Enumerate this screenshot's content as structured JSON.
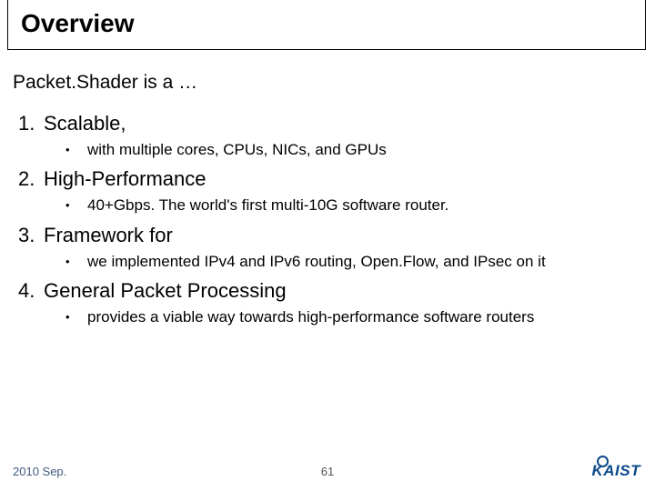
{
  "title": "Overview",
  "intro": "Packet.Shader is a …",
  "items": [
    {
      "head": "Scalable,",
      "sub": "with multiple cores, CPUs, NICs, and GPUs"
    },
    {
      "head": "High-Performance",
      "sub": "40+Gbps. The world's first multi-10G software router."
    },
    {
      "head": "Framework for",
      "sub": "we implemented IPv4 and IPv6 routing, Open.Flow, and IPsec on it"
    },
    {
      "head": "General Packet Processing",
      "sub": "provides a viable way towards high-performance software routers"
    }
  ],
  "footer": {
    "date": "2010 Sep.",
    "page": "61",
    "logo_text": "KAIST"
  }
}
